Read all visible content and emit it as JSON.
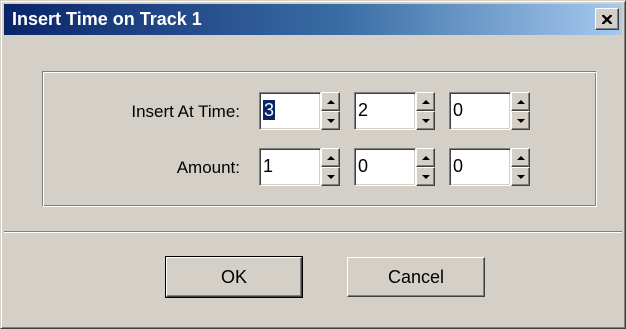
{
  "window": {
    "title": "Insert Time on Track 1",
    "close_icon": "close-icon"
  },
  "form": {
    "insert_at_time": {
      "label": "Insert  At Time:",
      "fields": [
        "3",
        "2",
        "0"
      ]
    },
    "amount": {
      "label": "Amount:",
      "fields": [
        "1",
        "0",
        "0"
      ]
    }
  },
  "buttons": {
    "ok": "OK",
    "cancel": "Cancel"
  },
  "colors": {
    "titlebar_start": "#0a246a",
    "titlebar_end": "#a6caf0",
    "face": "#d4d0c8",
    "selection": "#0a246a"
  }
}
